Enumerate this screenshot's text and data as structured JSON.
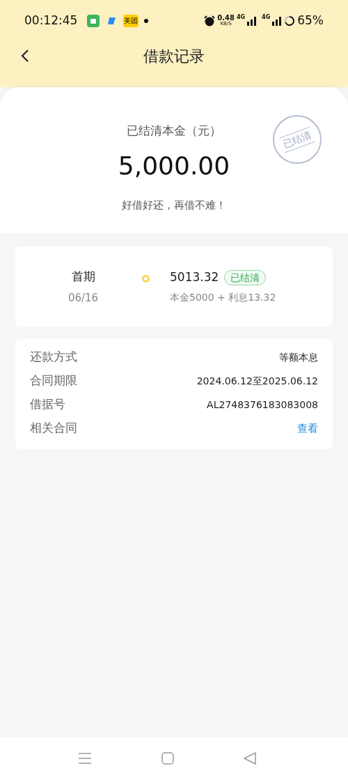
{
  "status_bar": {
    "time": "00:12:45",
    "app_badge": "美团",
    "speed_value": "0.48",
    "speed_unit": "KB/S",
    "network_1": "4G",
    "network_2": "4G",
    "battery": "65%"
  },
  "header": {
    "title": "借款记录"
  },
  "summary": {
    "label": "已结清本金（元）",
    "amount": "5,000.00",
    "slogan": "好借好还，再借不难！",
    "stamp": "已结清"
  },
  "installments": [
    {
      "name": "首期",
      "date": "06/16",
      "amount": "5013.32",
      "status": "已结清",
      "settled": true,
      "breakdown": "本金5000 + 利息13.32"
    }
  ],
  "details": [
    {
      "label": "还款方式",
      "value": "等额本息",
      "kind": "text"
    },
    {
      "label": "合同期限",
      "value": "2024.06.12至2025.06.12",
      "kind": "text"
    },
    {
      "label": "借据号",
      "value": "AL2748376183083008",
      "kind": "text"
    },
    {
      "label": "相关合同",
      "value": "查看",
      "kind": "link"
    }
  ]
}
